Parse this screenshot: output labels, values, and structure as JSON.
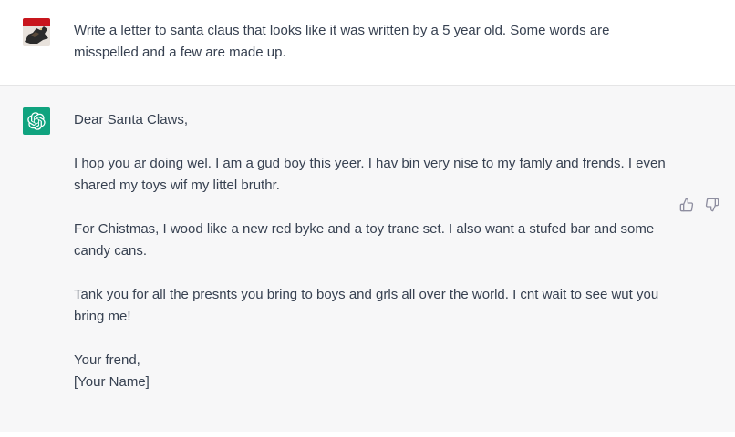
{
  "conversation": {
    "user_message": {
      "avatar": "user-avatar-image",
      "text": "Write a letter to santa claus that looks like it was written by a 5 year old. Some words are misspelled and a few are made up."
    },
    "assistant_message": {
      "avatar": "openai-logo-icon",
      "greeting": "Dear Santa Claws,",
      "paragraph1": "I hop you ar doing wel. I am a gud boy this yeer. I hav bin very nise to my famly and frends. I even shared my toys wif my littel bruthr.",
      "paragraph2": "For Chistmas, I wood like a new red byke and a toy trane set. I also want a stufed bar and some candy cans.",
      "paragraph3": "Tank you for all the presnts you bring to boys and grls all over the world. I cnt wait to see wut you bring me!",
      "closing": "Your frend,",
      "signature": "[Your Name]"
    },
    "actions": {
      "thumbs_up_icon": "thumbs-up-icon",
      "thumbs_down_icon": "thumbs-down-icon"
    }
  },
  "colors": {
    "user_bg": "#ffffff",
    "assistant_bg": "#f7f7f8",
    "brand": "#10a37f",
    "text": "#374151"
  }
}
